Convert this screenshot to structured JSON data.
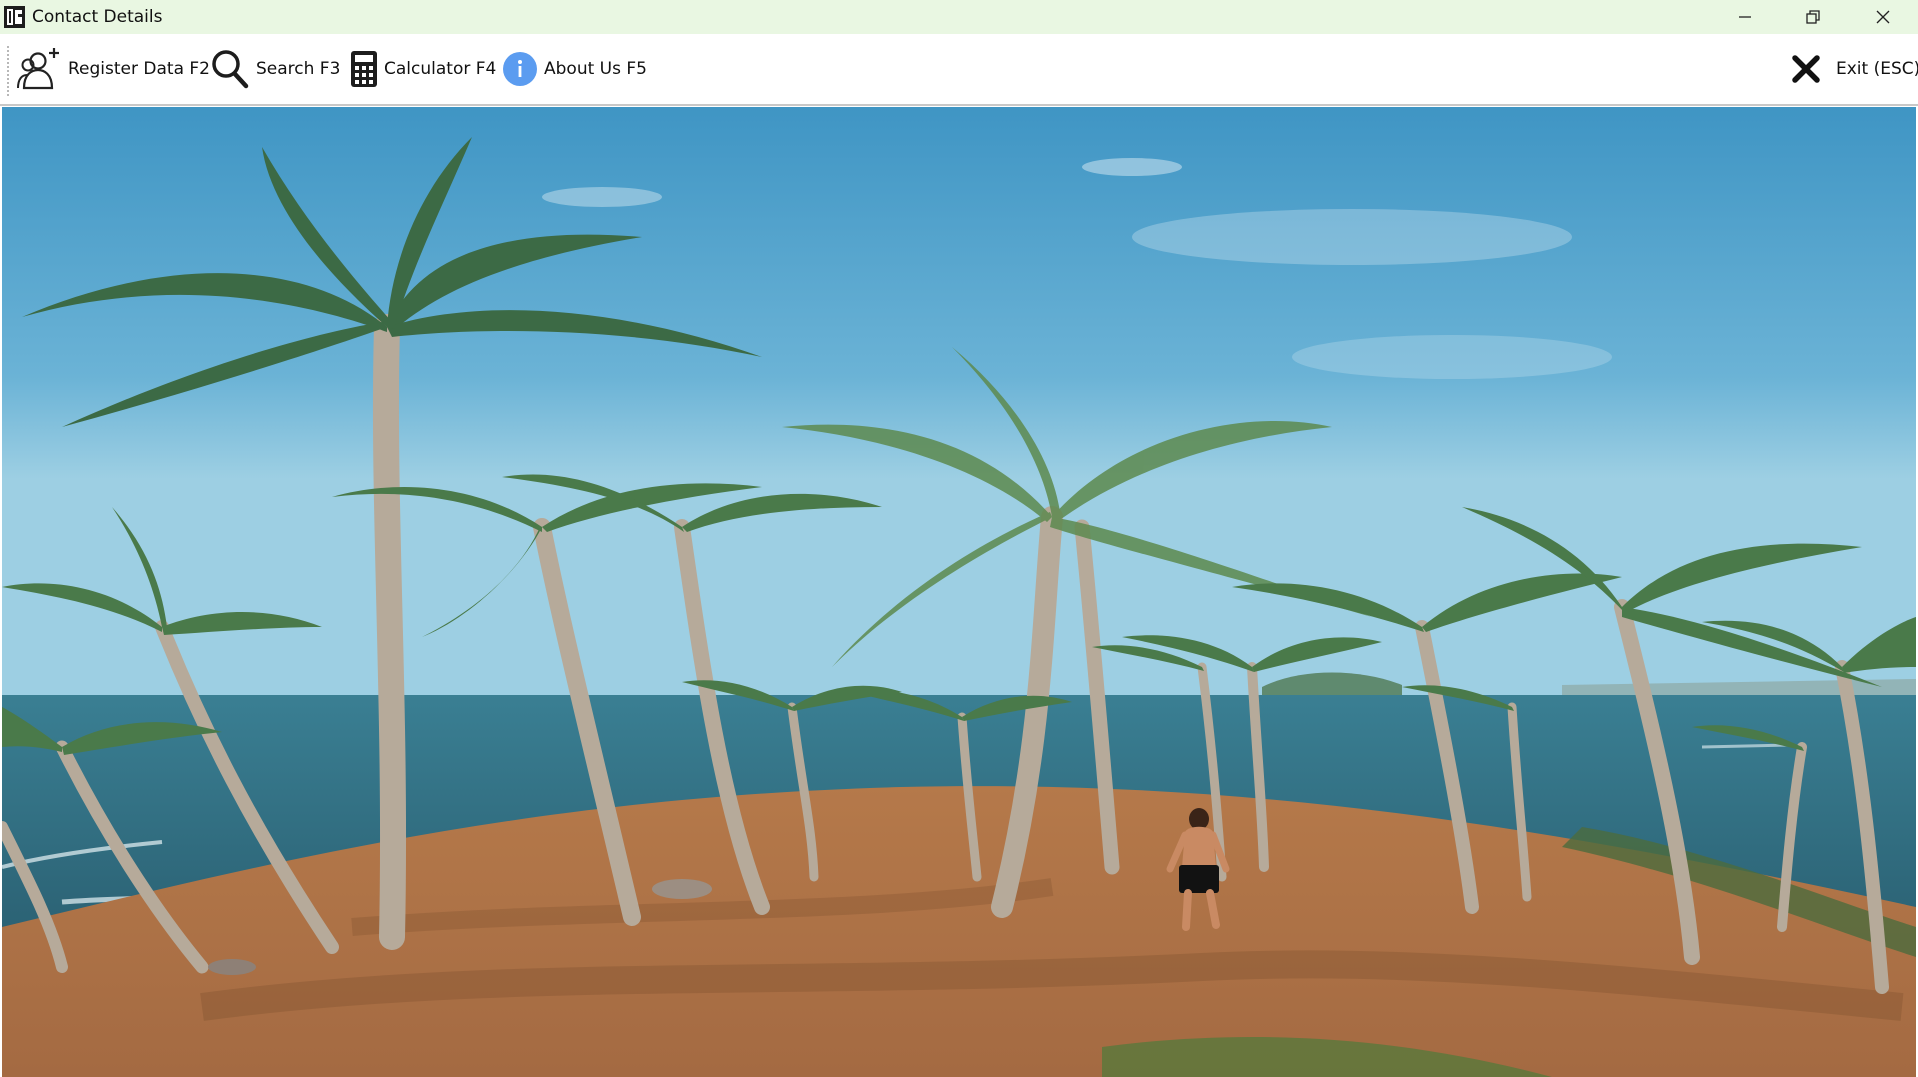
{
  "window": {
    "title": "Contact Details",
    "controls": [
      "minimize",
      "restore",
      "close"
    ]
  },
  "toolbar": {
    "register_label": "Register Data F2",
    "search_label": "Search F3",
    "calculator_label": "Calculator F4",
    "about_label": "About Us F5",
    "exit_label": "Exit (ESC)"
  },
  "icons": {
    "register": "add-user-icon",
    "search": "search-icon",
    "calculator": "calculator-icon",
    "about": "info-icon",
    "exit": "close-x-icon"
  },
  "colors": {
    "titlebar": "#e9f7e2",
    "info_icon": "#5b9cf0",
    "sky": "#5aa7cf",
    "sea": "#2f6f83",
    "ground": "#b0784a"
  }
}
